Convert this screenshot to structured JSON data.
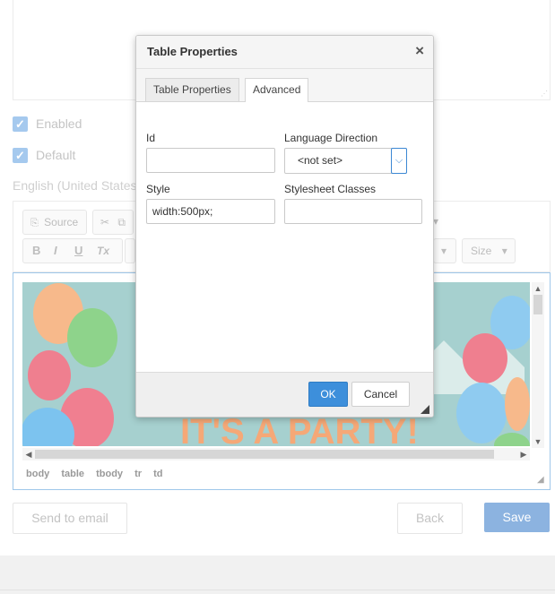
{
  "form": {
    "enabled_label": "Enabled",
    "default_label": "Default",
    "language_label": "English (United States)"
  },
  "editor": {
    "toolbar": {
      "source_label": "Source",
      "bold": "B",
      "italic": "I",
      "underline": "U",
      "remove_format": "Tx",
      "size_label": "Size"
    },
    "image_text": "IT'S A PARTY!",
    "path": [
      "body",
      "table",
      "tbody",
      "tr",
      "td"
    ]
  },
  "actions": {
    "send_email": "Send to email",
    "back": "Back",
    "save": "Save"
  },
  "dialog": {
    "title": "Table Properties",
    "close_glyph": "×",
    "tabs": [
      {
        "label": "Table Properties",
        "active": false
      },
      {
        "label": "Advanced",
        "active": true
      }
    ],
    "fields": {
      "id_label": "Id",
      "id_value": "",
      "lang_dir_label": "Language Direction",
      "lang_dir_value": "<not set>",
      "style_label": "Style",
      "style_value": "width:500px;",
      "classes_label": "Stylesheet Classes",
      "classes_value": ""
    },
    "ok": "OK",
    "cancel": "Cancel"
  },
  "colors": {
    "accent": "#3d8fdb",
    "save_button": "#8cb3e0",
    "checkbox": "#a5c9ee",
    "image_bg": "#9fcaca"
  },
  "icons": [
    "close-icon",
    "check-icon",
    "source-icon",
    "cut-icon",
    "copy-icon",
    "chevron-down-icon",
    "resize-grip-icon"
  ]
}
